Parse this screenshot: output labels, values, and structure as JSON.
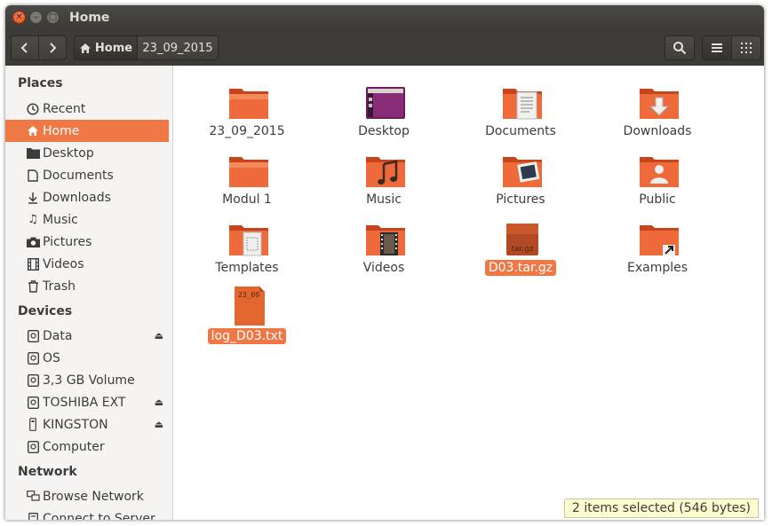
{
  "window": {
    "title": "Home"
  },
  "toolbar": {
    "back_label": "‹",
    "forward_label": "›",
    "breadcrumbs": [
      "Home",
      "23_09_2015"
    ]
  },
  "sidebar": {
    "places_header": "Places",
    "places": [
      "Recent",
      "Home",
      "Desktop",
      "Documents",
      "Downloads",
      "Music",
      "Pictures",
      "Videos",
      "Trash"
    ],
    "devices_header": "Devices",
    "devices": [
      "Data",
      "OS",
      "3,3 GB Volume",
      "TOSHIBA EXT",
      "KINGSTON",
      "Computer"
    ],
    "network_header": "Network",
    "network": [
      "Browse Network",
      "Connect to Server"
    ]
  },
  "files": [
    {
      "name": "23_09_2015",
      "kind": "folder"
    },
    {
      "name": "Desktop",
      "kind": "desktop"
    },
    {
      "name": "Documents",
      "kind": "documents"
    },
    {
      "name": "Downloads",
      "kind": "downloads"
    },
    {
      "name": "Modul 1",
      "kind": "folder"
    },
    {
      "name": "Music",
      "kind": "music"
    },
    {
      "name": "Pictures",
      "kind": "pictures"
    },
    {
      "name": "Public",
      "kind": "public"
    },
    {
      "name": "Templates",
      "kind": "templates"
    },
    {
      "name": "Videos",
      "kind": "videos"
    },
    {
      "name": "D03.tar.gz",
      "kind": "archive",
      "icon_text": "tar.gz"
    },
    {
      "name": "Examples",
      "kind": "examples"
    },
    {
      "name": "log_D03.txt",
      "kind": "text",
      "icon_text": "23_09"
    }
  ],
  "status": "2 items selected  (546 bytes)",
  "colors": {
    "accent": "#f07746",
    "folder": "#e9592b",
    "toolbar": "#3c3b37"
  }
}
